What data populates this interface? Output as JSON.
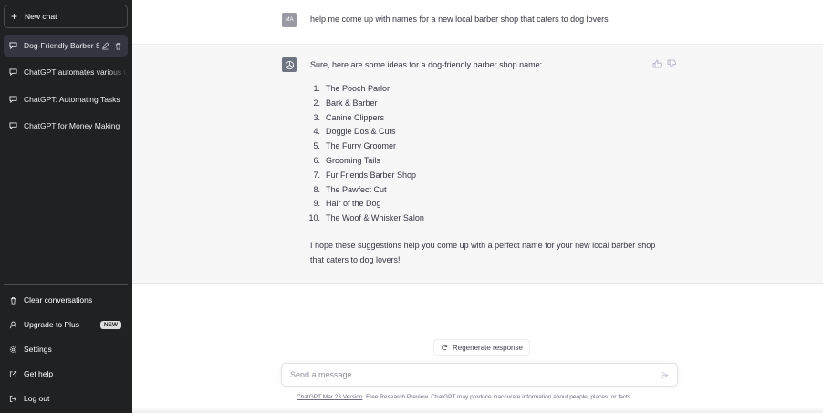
{
  "sidebar": {
    "new_chat_label": "New chat",
    "conversations": [
      {
        "label": "Dog-Friendly Barber S"
      },
      {
        "label": "ChatGPT automates various t"
      },
      {
        "label": "ChatGPT: Automating Tasks"
      },
      {
        "label": "ChatGPT for Money Making"
      }
    ],
    "menu": [
      {
        "label": "Clear conversations",
        "icon": "trash-icon"
      },
      {
        "label": "Upgrade to Plus",
        "icon": "user-icon",
        "badge": "NEW"
      },
      {
        "label": "Settings",
        "icon": "gear-icon"
      },
      {
        "label": "Get help",
        "icon": "external-link-icon"
      },
      {
        "label": "Log out",
        "icon": "log-out-icon"
      }
    ]
  },
  "chat": {
    "user_initials": "MA",
    "user_message": "help me come up with names for a new local barber shop that caters to dog lovers",
    "bot_intro": "Sure, here are some ideas for a dog-friendly barber shop name:",
    "names": [
      {
        "num": "1.",
        "text": "The Pooch Parlor"
      },
      {
        "num": "2.",
        "text": "Bark & Barber"
      },
      {
        "num": "3.",
        "text": "Canine Clippers"
      },
      {
        "num": "4.",
        "text": "Doggie Dos & Cuts"
      },
      {
        "num": "5.",
        "text": "The Furry Groomer"
      },
      {
        "num": "6.",
        "text": "Grooming Tails"
      },
      {
        "num": "7.",
        "text": "Fur Friends Barber Shop"
      },
      {
        "num": "8.",
        "text": "The Pawfect Cut"
      },
      {
        "num": "9.",
        "text": "Hair of the Dog"
      },
      {
        "num": "10.",
        "text": "The Woof & Whisker Salon"
      }
    ],
    "closing": "I hope these suggestions help you come up with a perfect name for your new local barber shop that caters to dog lovers!"
  },
  "composer": {
    "regenerate_label": "Regenerate response",
    "placeholder": "Send a message...",
    "footer_link": "ChatGPT Mar 23 Version",
    "footer_text": ". Free Research Preview. ChatGPT may produce inaccurate information about people, places, or facts"
  },
  "colors": {
    "sidebar_bg": "#202123",
    "active_item_bg": "#343541",
    "bot_row_bg": "#f7f7f8"
  }
}
